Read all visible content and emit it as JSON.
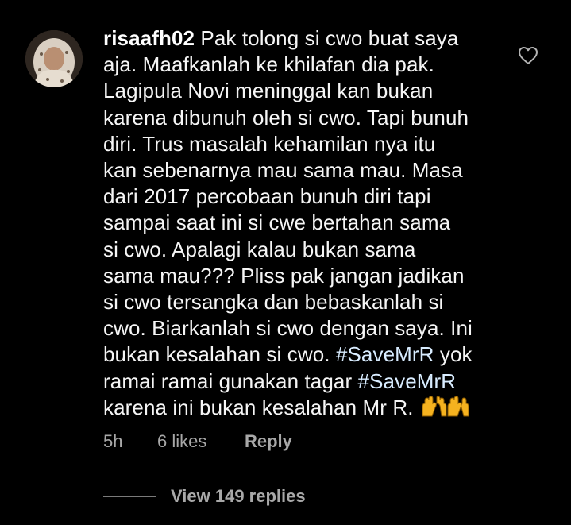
{
  "comment": {
    "username": "risaafh02",
    "text_lines": [
      "Pak tolong si cwo buat saya",
      "aja. Maafkanlah ke khilafan dia pak.",
      "Lagipula Novi meninggal kan bukan",
      "karena dibunuh oleh si cwo. Tapi bunuh",
      "diri. Trus masalah kehamilan nya itu",
      "kan sebenarnya mau sama mau. Masa",
      "dari 2017 percobaan bunuh diri tapi",
      "sampai saat ini si cwe bertahan sama",
      "si cwo. Apalagi kalau bukan sama",
      "sama mau??? Pliss pak jangan jadikan",
      "si cwo tersangka dan bebaskanlah si",
      "cwo. Biarkanlah si cwo dengan saya. Ini",
      "bukan kesalahan si cwo."
    ],
    "hashtag1": "#SaveMrR",
    "after_hashtag1": " yok",
    "line14_prefix": "ramai ramai gunakan tagar ",
    "hashtag2": "#SaveMrR",
    "last_line": "karena ini bukan kesalahan Mr R.",
    "emoji": "raising-hands-emoji",
    "time": "5h",
    "likes": "6 likes",
    "reply_label": "Reply",
    "view_replies": "View 149 replies"
  },
  "colors": {
    "background": "#000000",
    "text": "#f5f5f5",
    "meta": "#a8a8a8"
  }
}
